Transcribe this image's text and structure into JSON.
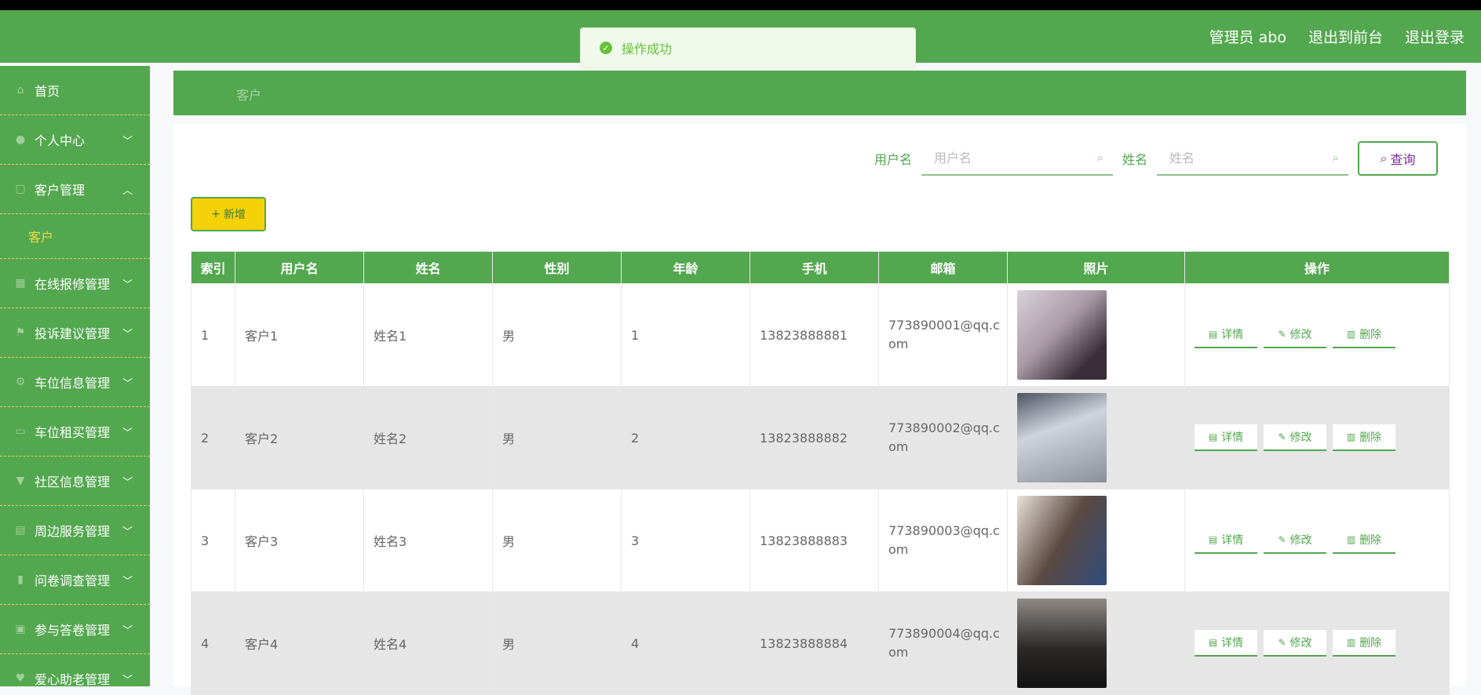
{
  "header": {
    "admin_label": "管理员 abo",
    "to_front": "退出到前台",
    "logout": "退出登录"
  },
  "toast": {
    "message": "操作成功"
  },
  "sidebar": {
    "items": [
      {
        "label": "首页",
        "icon": "home-icon"
      },
      {
        "label": "个人中心",
        "icon": "user-icon"
      },
      {
        "label": "客户管理",
        "icon": "grid-icon"
      },
      {
        "label": "客户",
        "icon": ""
      },
      {
        "label": "在线报修管理",
        "icon": "apps-icon"
      },
      {
        "label": "投诉建议管理",
        "icon": "flag-icon"
      },
      {
        "label": "车位信息管理",
        "icon": "gear-icon"
      },
      {
        "label": "车位租买管理",
        "icon": "tag-icon"
      },
      {
        "label": "社区信息管理",
        "icon": "cup-icon"
      },
      {
        "label": "周边服务管理",
        "icon": "doc-icon"
      },
      {
        "label": "问卷调查管理",
        "icon": "chart-icon"
      },
      {
        "label": "参与答卷管理",
        "icon": "clipboard-icon"
      },
      {
        "label": "爱心助老管理",
        "icon": "heart-icon"
      }
    ]
  },
  "breadcrumb": {
    "current": "客户"
  },
  "search": {
    "username_label": "用户名",
    "username_placeholder": "用户名",
    "name_label": "姓名",
    "name_placeholder": "姓名",
    "query_label": "查询"
  },
  "add_label": "新增",
  "table": {
    "headers": [
      "索引",
      "用户名",
      "姓名",
      "性别",
      "年龄",
      "手机",
      "邮箱",
      "照片",
      "操作"
    ],
    "rows": [
      {
        "index": "1",
        "username": "客户1",
        "name": "姓名1",
        "gender": "男",
        "age": "1",
        "phone": "13823888881",
        "email": "773890001@qq.com"
      },
      {
        "index": "2",
        "username": "客户2",
        "name": "姓名2",
        "gender": "男",
        "age": "2",
        "phone": "13823888882",
        "email": "773890002@qq.com"
      },
      {
        "index": "3",
        "username": "客户3",
        "name": "姓名3",
        "gender": "男",
        "age": "3",
        "phone": "13823888883",
        "email": "773890003@qq.com"
      },
      {
        "index": "4",
        "username": "客户4",
        "name": "姓名4",
        "gender": "男",
        "age": "4",
        "phone": "13823888884",
        "email": "773890004@qq.com"
      }
    ],
    "actions": {
      "detail": "详情",
      "edit": "修改",
      "delete": "删除"
    }
  },
  "colors": {
    "primary": "#53a74f",
    "accent_yellow": "#f5d107",
    "toast_green": "#67c23a"
  }
}
